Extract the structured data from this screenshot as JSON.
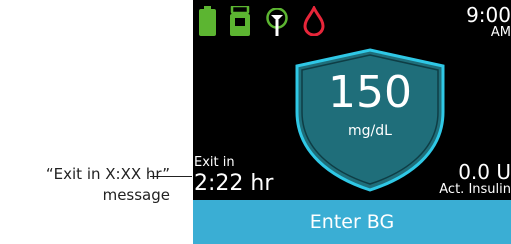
{
  "callout": {
    "line1": "“Exit in X:XX hr”",
    "line2": "message"
  },
  "status_bar": {
    "time": "9:00",
    "ampm": "AM",
    "icons": [
      "battery-icon",
      "insulin-cartridge-icon",
      "antenna-icon",
      "blood-drop-icon"
    ]
  },
  "glucose": {
    "value": "150",
    "unit": "mg/dL"
  },
  "exit": {
    "label": "Exit in",
    "time": "2:22 hr"
  },
  "insulin": {
    "value": "0.0 U",
    "label": "Act. Insulin"
  },
  "action": {
    "enter_bg_label": "Enter BG"
  },
  "colors": {
    "screen_bg": "#000000",
    "battery": "#5cb531",
    "shield_fill": "#1f6e7a",
    "shield_glow": "#2fc8e6",
    "drop": "#e8263a",
    "button": "#3aaed4"
  }
}
